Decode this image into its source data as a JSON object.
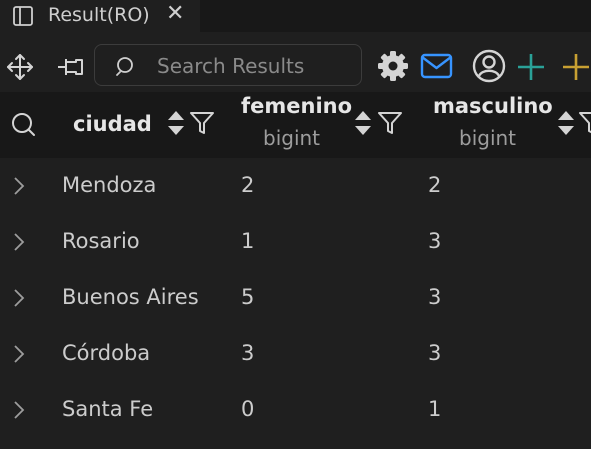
{
  "tab": {
    "title": "Result(RO)",
    "close": "✕"
  },
  "toolbar": {
    "search_placeholder": "Search Results",
    "colors": {
      "mail": "#3794ff",
      "plus_teal": "#2aa198",
      "plus_gold": "#c8a032"
    }
  },
  "columns": [
    {
      "name": "ciudad",
      "type": ""
    },
    {
      "name": "femenino",
      "type": "bigint"
    },
    {
      "name": "masculino",
      "type": "bigint"
    }
  ],
  "rows": [
    [
      "Mendoza",
      "2",
      "2"
    ],
    [
      "Rosario",
      "1",
      "3"
    ],
    [
      "Buenos Aires",
      "5",
      "3"
    ],
    [
      "Córdoba",
      "3",
      "3"
    ],
    [
      "Santa Fe",
      "0",
      "1"
    ]
  ]
}
